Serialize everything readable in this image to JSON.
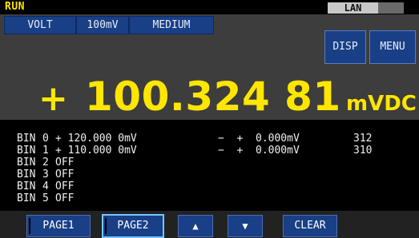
{
  "status": {
    "mode": "RUN",
    "interface": "LAN"
  },
  "tabs": {
    "function": "VOLT",
    "range": "100mV",
    "speed": "MEDIUM"
  },
  "buttons": {
    "disp": "DISP",
    "menu": "MENU"
  },
  "reading": {
    "sign": "+",
    "value": "100.324 81",
    "unit": "mVDC"
  },
  "bins": [
    {
      "label": "BIN",
      "num": "0",
      "value": "+ 120.000 0mV",
      "sign": "−  +",
      "limit": "0.000mV",
      "count": "312"
    },
    {
      "label": "BIN",
      "num": "1",
      "value": "+ 110.000 0mV",
      "sign": "−  +",
      "limit": "0.000mV",
      "count": "310"
    },
    {
      "label": "BIN",
      "num": "2",
      "value": "OFF",
      "sign": "",
      "limit": "",
      "count": ""
    },
    {
      "label": "BIN",
      "num": "3",
      "value": "OFF",
      "sign": "",
      "limit": "",
      "count": ""
    },
    {
      "label": "BIN",
      "num": "4",
      "value": "OFF",
      "sign": "",
      "limit": "",
      "count": ""
    },
    {
      "label": "BIN",
      "num": "5",
      "value": "OFF",
      "sign": "",
      "limit": "",
      "count": ""
    }
  ],
  "footer": {
    "page1": "PAGE1",
    "page2": "PAGE2",
    "up": "▲",
    "down": "▼",
    "clear": "CLEAR"
  }
}
